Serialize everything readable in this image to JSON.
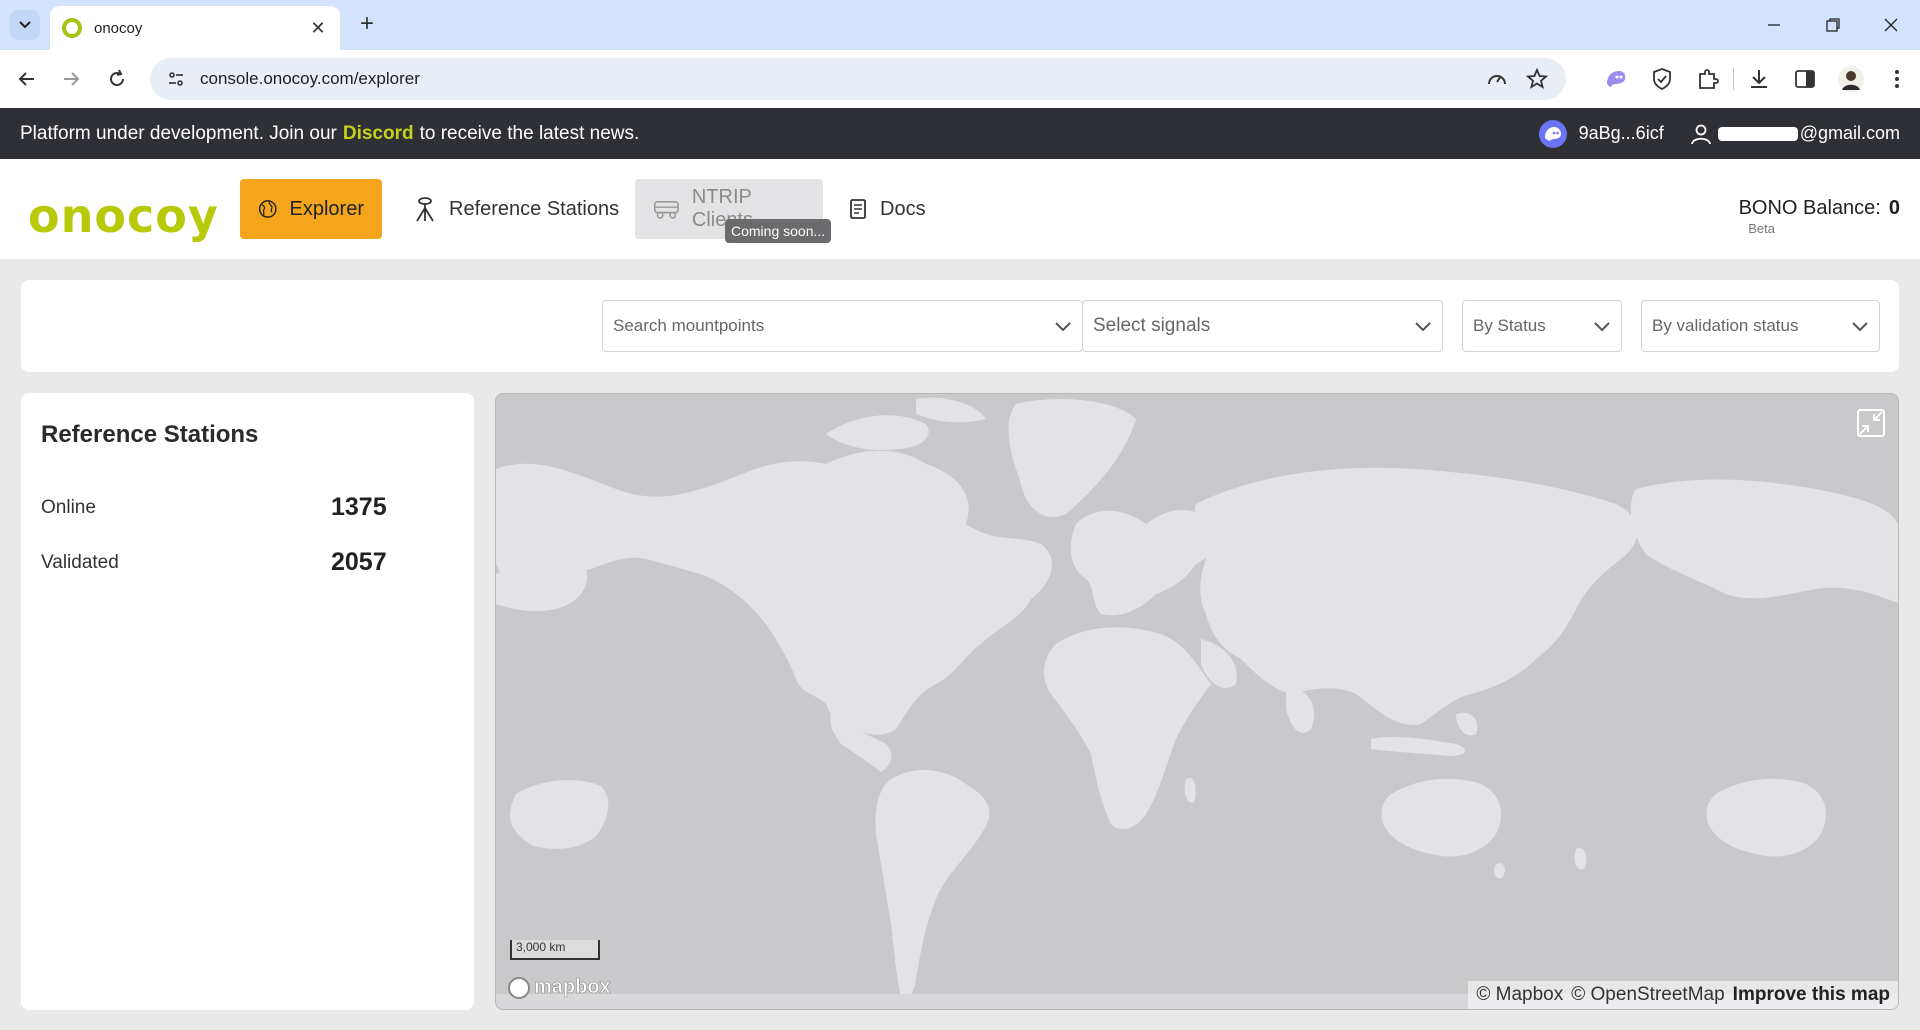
{
  "browser": {
    "tab_title": "onocoy",
    "url": "console.onocoy.com/explorer"
  },
  "banner": {
    "text_before": "Platform under development. Join our",
    "link": "Discord",
    "text_after": "to receive the latest news.",
    "wallet": "9aBg...6icf",
    "email_suffix": "@gmail.com"
  },
  "header": {
    "logo": "onocoy",
    "nav": {
      "explorer": "Explorer",
      "reference_stations": "Reference Stations",
      "ntrip_clients": "NTRIP Clients",
      "docs": "Docs"
    },
    "tooltip": "Coming soon...",
    "balance_label": "BONO Balance:",
    "balance_value": "0",
    "beta": "Beta"
  },
  "filters": {
    "search_mountpoints": "Search mountpoints",
    "select_signals": "Select signals",
    "by_status": "By Status",
    "by_validation_status": "By validation status"
  },
  "stats": {
    "title": "Reference Stations",
    "online_label": "Online",
    "online_value": "1375",
    "validated_label": "Validated",
    "validated_value": "2057"
  },
  "map": {
    "scale": "3,000 km",
    "logo": "mapbox",
    "attribution_mapbox": "© Mapbox",
    "attribution_osm": "© OpenStreetMap",
    "improve": "Improve this map"
  },
  "colors": {
    "accent": "#f4a51c",
    "brand": "#b8c90a",
    "banner_bg": "#2f3035",
    "map_water": "#c9c9cb",
    "map_land": "#e3e3e6"
  }
}
